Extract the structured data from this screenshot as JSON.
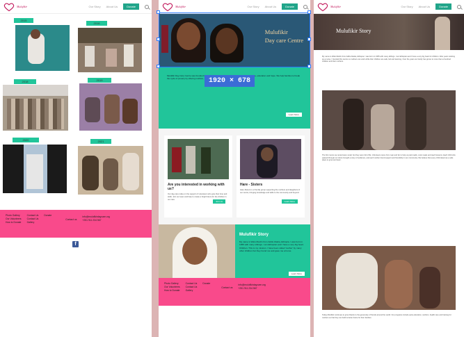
{
  "nav": {
    "brand": "Mulufikir",
    "home": "Our Story",
    "about": "About Us",
    "about_p2": "About Us",
    "donate": "Donate"
  },
  "gallery": {
    "years": [
      "2015",
      "2016",
      "2018",
      "2019",
      "2020",
      "2021"
    ]
  },
  "footer": {
    "col1": [
      "Photo Gallery",
      "Our Volunteers",
      "How to Donate"
    ],
    "col2": [
      "Contact Us",
      "Contact Us",
      "Gallery"
    ],
    "col3": [
      "Donate"
    ],
    "social_label": "Contact us",
    "email": "info@mulufikirdaycare.org",
    "phone": "+251 911 234 567"
  },
  "hero": {
    "title_line1": "Mulufikir",
    "title_line2": "Day care Centre",
    "size_badge": "1920 × 678"
  },
  "intro": {
    "text": "Mulufikir Day-Care Centre was founded in 2011 as a place where children and mothers find care, education and hope. We help families to break the cycle of poverty by offering nutrition, learning and support services in Addis Ababa.",
    "more": "Learn More"
  },
  "cards": [
    {
      "title": "Are you interested in working with us?",
      "text": "Our day-care relies on the support of volunteers who give their time and skills. Join our team and help to create a bright future for the children in our care.",
      "button": "Join Us"
    },
    {
      "title": "Hare - Sisters",
      "text": "Hare-Sisters is a friendly group supporting the mothers and daughters of our centre, bringing knowledge and skills to the community and beyond.",
      "button": "Learn More"
    }
  ],
  "story": {
    "title": "Mulufikir Story",
    "text": "My name is Walu Mesfin from Addis Ababa, Ethiopia. I was born in 1955 with many siblings. I am Ethiopian and I have a very big heart. Children. This is my mission. I have been called 'mother' by many other children but they found me and gave me a home.",
    "button": "Learn More"
  },
  "story_page": {
    "title": "Mulufikir Story",
    "intro": "My name is Walu Mesfin from Addis Ababa, Ethiopia. I was born in 1955 with many siblings. I am Ethiopian and I have a very big heart for children. After years working as a nurse, I founded this centre so mothers can work while their children are safe, fed and learning. Over the years our family has grown to more than a hundred children and their mothers.",
    "body1": "The first rooms we rented were small, but they were full of life. Volunteers came from near and far to help us paint walls, cook meals and teach lessons. Each child who passed through our doors brought a story of resilience, and each mother found support and friendship in our community. We believe that every child deserves a safe place to grow and learn.",
    "body2": "Today Mulufikir continues to grow thanks to the generosity of friends around the world. Our programs include early education, nutrition, health care and training for mothers so that they can build a better future for their families."
  }
}
